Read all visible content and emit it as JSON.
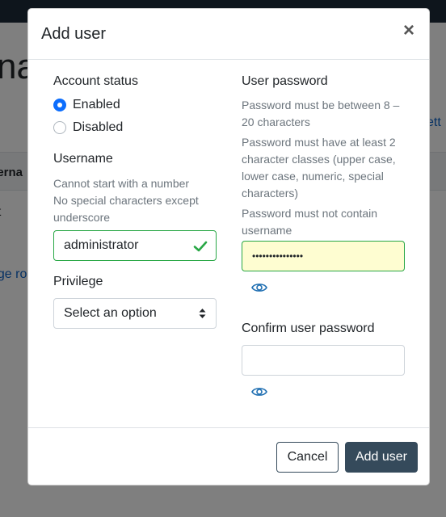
{
  "background": {
    "heading_fragment": "na",
    "table_header_fragment": "serna",
    "cell_fragment": "ot",
    "link_left_fragment": "ege ro",
    "link_right_fragment": "ett"
  },
  "modal": {
    "title": "Add user",
    "close_glyph": "×",
    "account_status": {
      "label": "Account status",
      "options": [
        {
          "label": "Enabled",
          "checked": true
        },
        {
          "label": "Disabled",
          "checked": false
        }
      ]
    },
    "username": {
      "label": "Username",
      "help": [
        "Cannot start with a number",
        "No special characters except underscore"
      ],
      "value": "administrator",
      "valid_icon": "check-icon"
    },
    "privilege": {
      "label": "Privilege",
      "selected": "Select an option"
    },
    "user_password": {
      "label": "User password",
      "help": [
        "Password must be between 8 – 20 characters",
        "Password must have at least 2 character classes (upper case, lower case, numeric, special characters)",
        "Password must not contain username"
      ],
      "masked_value": "•••••••••••••••",
      "toggle_icon": "eye-icon"
    },
    "confirm_password": {
      "label": "Confirm user password",
      "value": "",
      "toggle_icon": "eye-icon"
    },
    "footer": {
      "cancel_label": "Cancel",
      "submit_label": "Add user"
    }
  },
  "colors": {
    "primary_dark": "#354a5b",
    "valid_green": "#28a745",
    "link_blue": "#0b63c9",
    "autofill_yellow": "#fefdd1"
  }
}
